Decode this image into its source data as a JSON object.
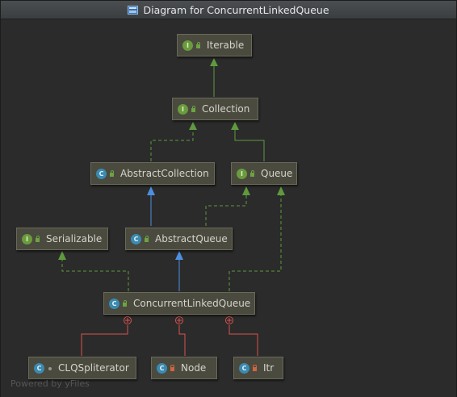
{
  "window": {
    "title": "Diagram for ConcurrentLinkedQueue"
  },
  "nodes": {
    "iterable": {
      "name": "Iterable",
      "badge": "I"
    },
    "collection": {
      "name": "Collection",
      "badge": "I"
    },
    "abstract_collection": {
      "name": "AbstractCollection",
      "badge": "C"
    },
    "queue": {
      "name": "Queue",
      "badge": "I"
    },
    "serializable": {
      "name": "Serializable",
      "badge": "I"
    },
    "abstract_queue": {
      "name": "AbstractQueue",
      "badge": "C"
    },
    "concurrent_linked_queue": {
      "name": "ConcurrentLinkedQueue",
      "badge": "C"
    },
    "clq_spliterator": {
      "name": "CLQSpliterator",
      "badge": "C"
    },
    "node": {
      "name": "Node",
      "badge": "C"
    },
    "itr": {
      "name": "Itr",
      "badge": "C"
    }
  },
  "footer": {
    "watermark": "Powered by yFiles"
  },
  "colors": {
    "implements_edge": "#5f9a3e",
    "extends_edge": "#4d8fe0",
    "inner_edge": "#d9534f",
    "node_bg": "#4a4a3f",
    "interface_badge": "#6a9b3d",
    "class_badge": "#3b8ab0"
  },
  "icons": {
    "title": "diagram-icon",
    "interface": "interface-badge-icon",
    "class": "class-badge-icon",
    "public": "public-visibility-icon",
    "private": "private-visibility-icon",
    "package_private": "package-visibility-icon",
    "inner_class_marker": "circle-plus-icon"
  }
}
